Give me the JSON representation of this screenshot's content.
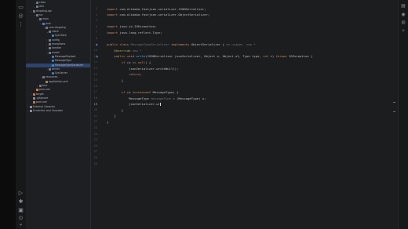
{
  "project_tree": [
    {
      "label": "class",
      "depth": 2,
      "icon": "folder",
      "arrow": "›"
    },
    {
      "label": "dist",
      "depth": 2,
      "icon": "folder",
      "arrow": "›"
    },
    {
      "label": "dingding-api",
      "depth": 1,
      "icon": "folder",
      "arrow": "⌄"
    },
    {
      "label": "src",
      "depth": 2,
      "icon": "folder",
      "arrow": "⌄"
    },
    {
      "label": "main",
      "depth": 3,
      "icon": "folder",
      "arrow": "⌄"
    },
    {
      "label": "java",
      "depth": 4,
      "icon": "src",
      "arrow": "⌄"
    },
    {
      "label": "com.dingding",
      "depth": 5,
      "icon": "folder",
      "arrow": "⌄"
    },
    {
      "label": "client",
      "depth": 6,
      "icon": "folder",
      "arrow": "⌄"
    },
    {
      "label": "SysClient",
      "depth": 7,
      "icon": "class",
      "arrow": ""
    },
    {
      "label": "config",
      "depth": 6,
      "icon": "folder",
      "arrow": "›"
    },
    {
      "label": "exceptions",
      "depth": 6,
      "icon": "folder",
      "arrow": "›"
    },
    {
      "label": "handler",
      "depth": 6,
      "icon": "folder",
      "arrow": "›"
    },
    {
      "label": "model",
      "depth": 6,
      "icon": "folder",
      "arrow": "⌄"
    },
    {
      "label": "MessagePayload",
      "depth": 7,
      "icon": "class",
      "arrow": ""
    },
    {
      "label": "MessageType",
      "depth": 7,
      "icon": "class",
      "arrow": ""
    },
    {
      "label": "MessageTypeSerializer",
      "depth": 7,
      "icon": "class",
      "arrow": "",
      "selected": true
    },
    {
      "label": "server",
      "depth": 6,
      "icon": "folder",
      "arrow": "⌄"
    },
    {
      "label": "SysServer",
      "depth": 7,
      "icon": "class",
      "arrow": ""
    },
    {
      "label": "resources",
      "depth": 4,
      "icon": "folder",
      "arrow": "⌄"
    },
    {
      "label": "application.yml",
      "depth": 5,
      "icon": "yml",
      "arrow": ""
    },
    {
      "label": "test",
      "depth": 3,
      "icon": "folder",
      "arrow": "›"
    },
    {
      "label": "pom.xml",
      "depth": 2,
      "icon": "xml",
      "arrow": ""
    },
    {
      "label": "target",
      "depth": 1,
      "icon": "out",
      "arrow": "›"
    },
    {
      "label": ".gitignore",
      "depth": 1,
      "icon": "lib",
      "arrow": ""
    },
    {
      "label": "pom.xml",
      "depth": 1,
      "icon": "xml",
      "arrow": ""
    },
    {
      "label": "External Libraries",
      "depth": 0,
      "icon": "lib",
      "arrow": "›"
    },
    {
      "label": "Scratches and Consoles",
      "depth": 0,
      "icon": "lib",
      "arrow": "›"
    }
  ],
  "line_numbers": [
    "3",
    "4",
    "5",
    "6",
    "7",
    "8",
    "9",
    "10",
    "11",
    "12",
    "13",
    "14",
    "15",
    "16",
    "17",
    "18",
    "19",
    "20",
    "21",
    "22",
    "23",
    "24",
    "25",
    "26",
    "27",
    "28",
    "29"
  ],
  "current_line": "19",
  "code_lines": [
    [
      {
        "t": "import ",
        "c": "kw"
      },
      {
        "t": "com.alibaba.fastjson.serializer.JSONSerializer;",
        "c": "cls"
      }
    ],
    [
      {
        "t": "import ",
        "c": "kw"
      },
      {
        "t": "com.alibaba.fastjson.serializer.ObjectSerializer;",
        "c": "cls"
      }
    ],
    [],
    [
      {
        "t": "import ",
        "c": "kw"
      },
      {
        "t": "java.io.IOException;",
        "c": "cls"
      }
    ],
    [
      {
        "t": "import ",
        "c": "kw"
      },
      {
        "t": "java.lang.reflect.Type;",
        "c": "cls"
      }
    ],
    [],
    [
      {
        "t": "public class ",
        "c": "kw"
      },
      {
        "t": "MessageTypeSerializer ",
        "c": "hint"
      },
      {
        "t": "implements ",
        "c": "kw"
      },
      {
        "t": "ObjectSerializer { ",
        "c": "cls"
      },
      {
        "t": "no usages  new *",
        "c": "hint"
      }
    ],
    [
      {
        "t": "    @Override ",
        "c": "ann"
      },
      {
        "t": "new *",
        "c": "hint"
      }
    ],
    [
      {
        "t": "    public void ",
        "c": "kw"
      },
      {
        "t": "write",
        "c": "fn"
      },
      {
        "t": "(JSONSerializer jsonSerializer, Object o, Object o1, Type type, ",
        "c": "cls"
      },
      {
        "t": "int ",
        "c": "kw"
      },
      {
        "t": "i) ",
        "c": "cls"
      },
      {
        "t": "throws ",
        "c": "kw"
      },
      {
        "t": "IOException {",
        "c": "cls"
      }
    ],
    [
      {
        "t": "        ",
        "c": "cls"
      },
      {
        "t": "if ",
        "c": "kw"
      },
      {
        "t": "(o == ",
        "c": "cls"
      },
      {
        "t": "null",
        "c": "kw"
      },
      {
        "t": ") {",
        "c": "cls"
      }
    ],
    [
      {
        "t": "            jsonSerializer.writeNull();",
        "c": "cls"
      }
    ],
    [
      {
        "t": "            ",
        "c": "cls"
      },
      {
        "t": "return",
        "c": "kw"
      },
      {
        "t": ";",
        "c": "cls"
      }
    ],
    [
      {
        "t": "        }",
        "c": "cls"
      }
    ],
    [],
    [
      {
        "t": "        ",
        "c": "cls"
      },
      {
        "t": "if ",
        "c": "kw"
      },
      {
        "t": "(o ",
        "c": "cls"
      },
      {
        "t": "instanceof ",
        "c": "kw"
      },
      {
        "t": "MessageType) {",
        "c": "cls"
      }
    ],
    [
      {
        "t": "            MessageType ",
        "c": "cls"
      },
      {
        "t": "messageType",
        "c": "hint"
      },
      {
        "t": " = (MessageType) o;",
        "c": "cls"
      }
    ],
    [
      {
        "t": "            jsonSerializer.wr",
        "c": "cls"
      },
      {
        "t": "|",
        "c": "caret"
      }
    ],
    [
      {
        "t": "        }",
        "c": "cls"
      }
    ],
    [
      {
        "t": "    }",
        "c": "cls"
      }
    ],
    [
      {
        "t": "}",
        "c": "cls"
      }
    ],
    [],
    [],
    [],
    [],
    [],
    [],
    []
  ],
  "left_toolbar_icons": [
    "folder-icon",
    "commit-icon",
    "structure-icon",
    "more-icon",
    "run-icon",
    "debug-icon",
    "terminal-icon",
    "problems-icon",
    "git-icon"
  ],
  "right_toolbar_icons": [
    "notifications-icon",
    "database-icon",
    "maven-icon",
    "ai-assistant-icon"
  ]
}
